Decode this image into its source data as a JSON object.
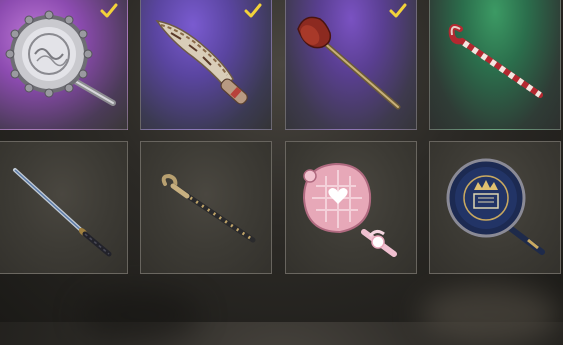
{
  "inventory": {
    "items": [
      {
        "icon": "silver-pan-icon",
        "checked": true
      },
      {
        "icon": "machete-icon",
        "checked": true
      },
      {
        "icon": "plunger-icon",
        "checked": true
      },
      {
        "icon": "candy-cane-crowbar-icon",
        "checked": false
      },
      {
        "icon": "katana-icon",
        "checked": false
      },
      {
        "icon": "ornate-cane-icon",
        "checked": false
      },
      {
        "icon": "pink-heart-pan-icon",
        "checked": false
      },
      {
        "icon": "blue-crown-pan-icon",
        "checked": false
      }
    ]
  },
  "colors": {
    "checkmark": "#f2d23a",
    "tile_border": "#c8c3b9"
  }
}
